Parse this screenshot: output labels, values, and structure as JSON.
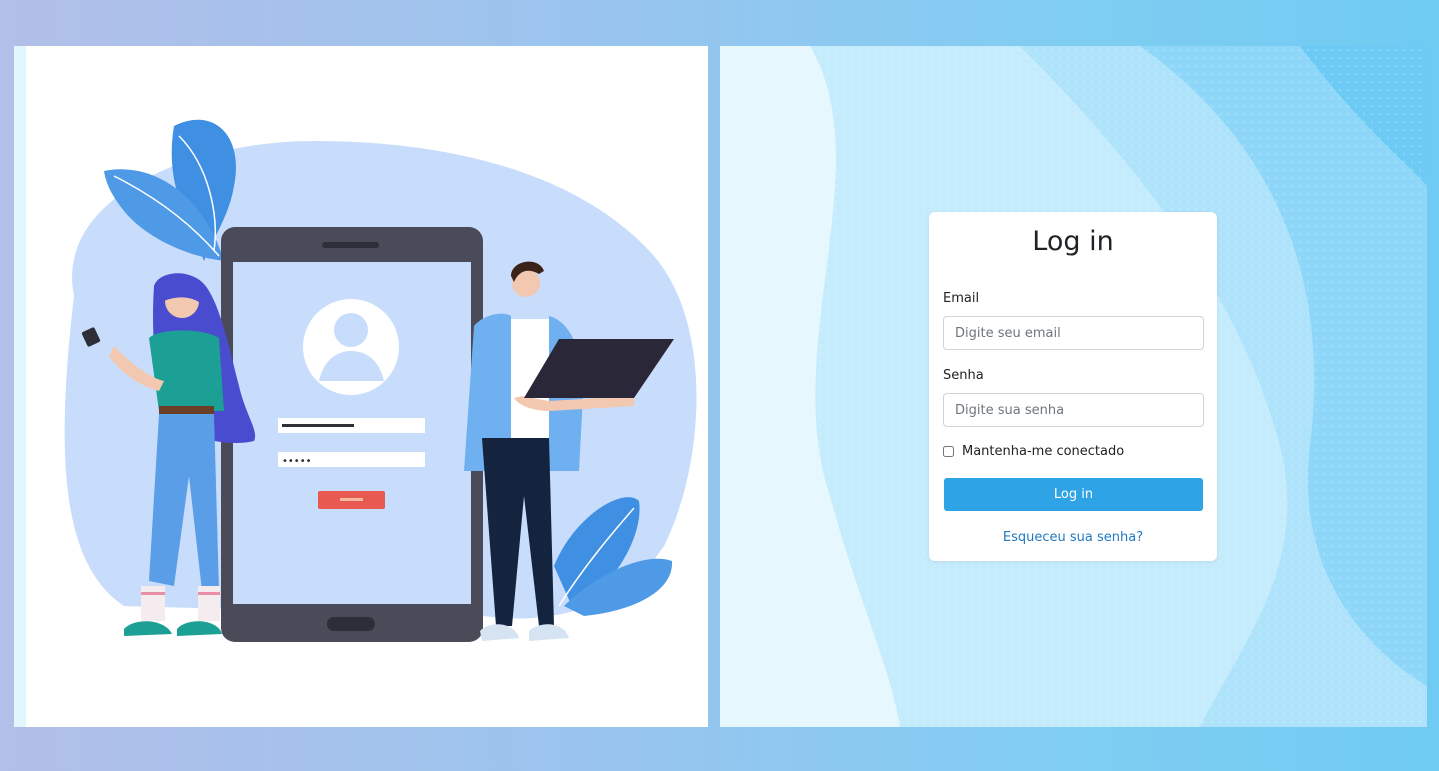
{
  "login": {
    "title": "Log in",
    "email_label": "Email",
    "email_placeholder": "Digite seu email",
    "password_label": "Senha",
    "password_placeholder": "Digite sua senha",
    "remember_label": "Mantenha-me conectado",
    "remember_checked": false,
    "submit_label": "Log in",
    "forgot_link": "Esqueceu sua senha?"
  },
  "illustration": {
    "password_mask": "•••••"
  },
  "colors": {
    "primary_button": "#2ea3e6",
    "link": "#1f7ac4",
    "illustration_blue": "#3f8fe2",
    "screen_bg": "#c8dcfb"
  }
}
